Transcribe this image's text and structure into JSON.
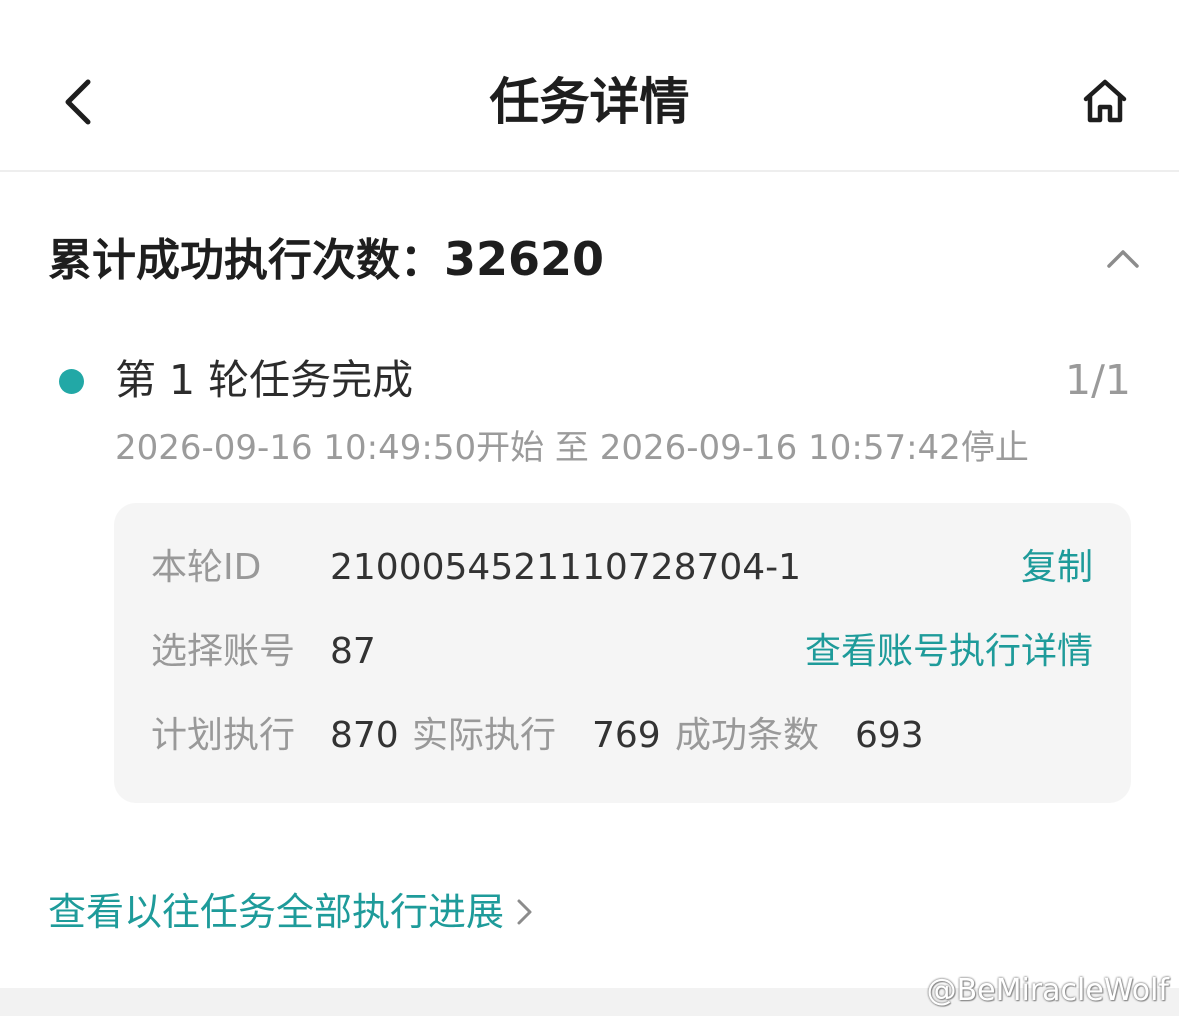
{
  "header": {
    "title": "任务详情",
    "back_icon": "chevron-left-icon",
    "home_icon": "home-icon"
  },
  "summary": {
    "label": "累计成功执行次数：",
    "value": "32620",
    "toggle_icon": "chevron-up-icon"
  },
  "round": {
    "title": "第 1 轮任务完成",
    "progress": "1/1",
    "status_color": "#22a8a6",
    "time_range": "2026-09-16 10:49:50开始 至 2026-09-16 10:57:42停止",
    "details": {
      "id_label": "本轮ID",
      "id_value": "210005452111072870​4-1",
      "copy_label": "复制",
      "account_label": "选择账号",
      "account_value": "87",
      "account_link": "查看账号执行详情",
      "planned_label": "计划执行",
      "planned_value": "870",
      "actual_label": "实际执行",
      "actual_value": "769",
      "success_label": "成功条数",
      "success_value": "693"
    }
  },
  "footer": {
    "history_link": "查看以往任务全部执行进展"
  },
  "watermark": "@BeMiracleWolf",
  "colors": {
    "accent": "#1e9b9a",
    "card_bg": "#f5f5f5"
  }
}
